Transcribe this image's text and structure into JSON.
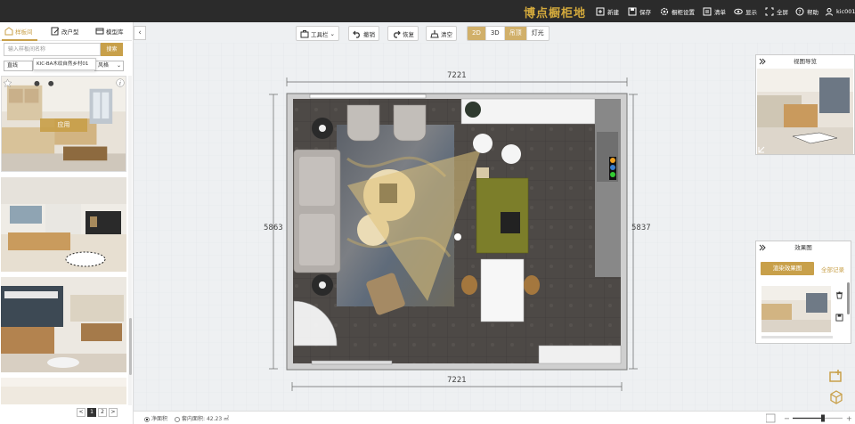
{
  "app": {
    "logo": "博点橱柜地"
  },
  "topbar": {
    "items": [
      {
        "label": "新建",
        "icon": "new-file-icon"
      },
      {
        "label": "保存",
        "icon": "save-icon"
      },
      {
        "label": "橱柜设置",
        "icon": "settings-icon"
      },
      {
        "label": "清单",
        "icon": "list-icon"
      },
      {
        "label": "显示",
        "icon": "eye-icon"
      },
      {
        "label": "全屏",
        "icon": "fullscreen-icon"
      },
      {
        "label": "帮助",
        "icon": "help-icon"
      },
      {
        "label": "kic001",
        "icon": "user-icon"
      }
    ]
  },
  "left_panel": {
    "tabs": [
      {
        "label": "样板间",
        "active": true,
        "icon": "sample-room-icon"
      },
      {
        "label": "改户型",
        "active": false,
        "icon": "edit-floorplan-icon"
      },
      {
        "label": "模型库",
        "active": false,
        "icon": "model-library-icon"
      }
    ],
    "search": {
      "placeholder": "输入样板间名称",
      "button": "搜索"
    },
    "filters": [
      {
        "value": "直线"
      },
      {
        "value": "风格"
      }
    ],
    "tooltip": "KIC-BA木纹自然乡村01",
    "apply_button": "应用",
    "info_label": "i",
    "pager": {
      "prev": "<",
      "pages": [
        "1",
        "2"
      ],
      "next": ">",
      "current": "1"
    }
  },
  "toolbar": {
    "tools": {
      "label": "工具栏"
    },
    "undo": {
      "label": "撤销"
    },
    "redo": {
      "label": "恢复"
    },
    "clear": {
      "label": "清空"
    },
    "views": [
      {
        "label": "2D",
        "active": true
      },
      {
        "label": "3D",
        "active": false
      },
      {
        "label": "吊顶",
        "active": true
      },
      {
        "label": "灯光",
        "active": false
      }
    ]
  },
  "floorplan": {
    "dim_top": "7221",
    "dim_bottom": "7221",
    "dim_left": "5863",
    "dim_right": "5837"
  },
  "nav_panel": {
    "title": "视图导览"
  },
  "effect_panel": {
    "title": "效果图",
    "render_button": "渲染效果图",
    "all_records": "全部记录"
  },
  "bottombar": {
    "net_area_label": "净面积",
    "inner_area_label": "套内面积",
    "inner_area_value": "42.23 ㎡"
  },
  "colors": {
    "accent": "#c8a04a",
    "topbar": "#2b2b2b",
    "floor": "#4a4644",
    "rug": "#6d6d6d"
  }
}
